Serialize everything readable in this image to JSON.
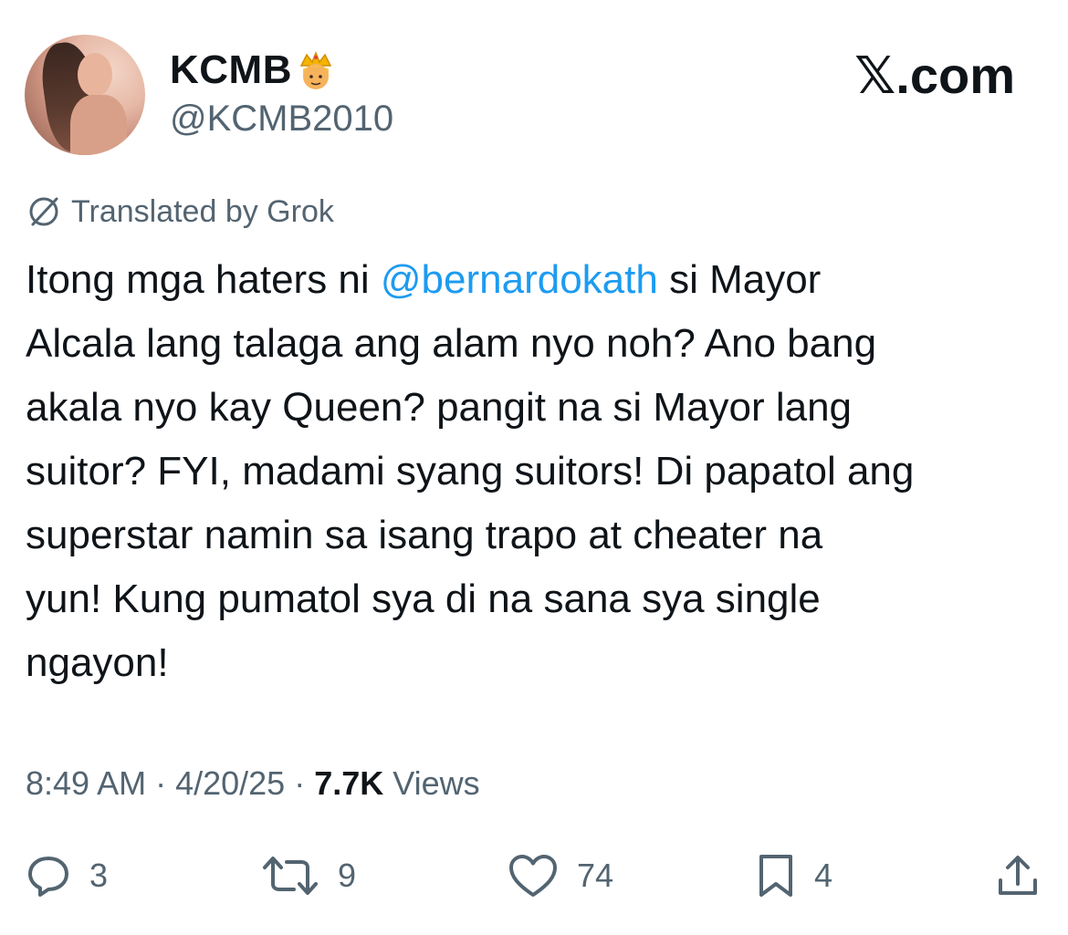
{
  "user": {
    "display_name": "KCMB",
    "handle": "@KCMB2010",
    "badge_icon": "crown-emoji-icon"
  },
  "brand": "𝕏.com",
  "translation": {
    "label": "Translated by Grok"
  },
  "tweet": {
    "lines": [
      {
        "before": "Itong mga haters ni ",
        "mention": "@bernardokath",
        "after": " si Mayor"
      },
      {
        "text": "Alcala lang talaga ang alam nyo noh? Ano bang"
      },
      {
        "text": "akala nyo kay Queen? pangit na si Mayor lang"
      },
      {
        "text": "suitor? FYI, madami syang suitors! Di papatol ang"
      },
      {
        "text": "superstar namin sa isang trapo at cheater na"
      },
      {
        "text": "yun! Kung pumatol sya di na sana sya single"
      },
      {
        "text": "ngayon!"
      }
    ]
  },
  "meta": {
    "time": "8:49 AM",
    "sep1": " · ",
    "date": "4/20/25",
    "sep2": " · ",
    "views_count": "7.7K",
    "views_label": " Views"
  },
  "actions": {
    "replies": "3",
    "reposts": "9",
    "likes": "74",
    "bookmarks": "4"
  },
  "colors": {
    "text": "#0f1419",
    "secondary": "#536471",
    "link": "#1d9bf0",
    "background": "#ffffff"
  }
}
